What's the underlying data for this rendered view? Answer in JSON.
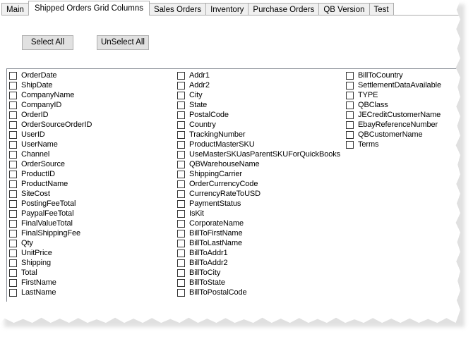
{
  "tabs": [
    {
      "label": "Main",
      "active": false
    },
    {
      "label": "Shipped Orders Grid Columns",
      "active": true
    },
    {
      "label": "Sales Orders",
      "active": false
    },
    {
      "label": "Inventory",
      "active": false
    },
    {
      "label": "Purchase Orders",
      "active": false
    },
    {
      "label": "QB Version",
      "active": false
    },
    {
      "label": "Test",
      "active": false
    }
  ],
  "buttons": {
    "select_all": "Select All",
    "unselect_all": "UnSelect All"
  },
  "columns": [
    [
      "OrderDate",
      "ShipDate",
      "CompanyName",
      "CompanyID",
      "OrderID",
      "OrderSourceOrderID",
      "UserID",
      "UserName",
      "Channel",
      "OrderSource",
      "ProductID",
      "ProductName",
      "SiteCost",
      "PostingFeeTotal",
      "PaypalFeeTotal",
      "FinalValueTotal",
      "FinalShippingFee",
      "Qty",
      "UnitPrice",
      "Shipping",
      "Total",
      "FirstName",
      "LastName"
    ],
    [
      "Addr1",
      "Addr2",
      "City",
      "State",
      "PostalCode",
      "Country",
      "TrackingNumber",
      "ProductMasterSKU",
      "UseMasterSKUasParentSKUForQuickBooks",
      "QBWarehouseName",
      "ShippingCarrier",
      "OrderCurrencyCode",
      "CurrencyRateToUSD",
      "PaymentStatus",
      "IsKit",
      "CorporateName",
      "BillToFirstName",
      "BillToLastName",
      "BillToAddr1",
      "BillToAddr2",
      "BillToCity",
      "BillToState",
      "BillToPostalCode"
    ],
    [
      "BillToCountry",
      "SettlementDataAvailable",
      "TYPE",
      "QBClass",
      "JECreditCustomerName",
      "EbayReferenceNumber",
      "QBCustomerName",
      "Terms"
    ]
  ]
}
